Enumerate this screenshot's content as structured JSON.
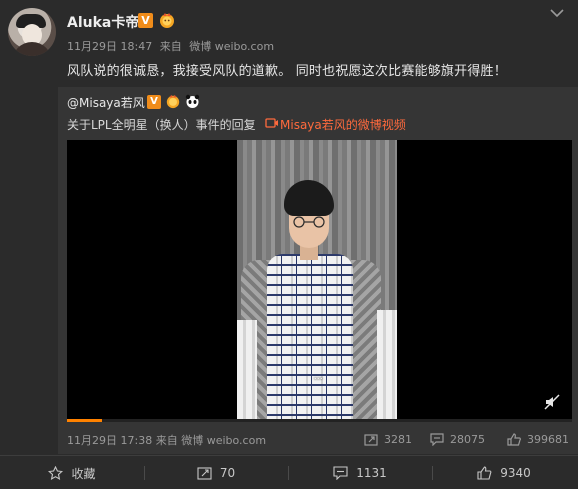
{
  "post": {
    "username": "Aluka卡帝",
    "verified_badge": "V",
    "date": "11月29日 18:47",
    "source_prefix": "来自",
    "source": "微博 weibo.com",
    "text": "风队说的很诚恳，我接受风队的道歉。 同时也祝愿这次比赛能够旗开得胜！"
  },
  "repost": {
    "username": "@Misaya若风",
    "verified_badge": "V",
    "title": "关于LPL全明星（换人）事件的回复",
    "video_link": "Misaya若风的微博视频",
    "video_subtitle": "…",
    "video_progress": 0.07,
    "date": "11月29日 17:38",
    "source_prefix": "来自",
    "source": "微博 weibo.com",
    "reposts": "3281",
    "comments": "28075",
    "likes": "399681"
  },
  "footer": {
    "favorite_label": "收藏",
    "repost_count": "70",
    "comment_count": "1131",
    "like_count": "9340"
  },
  "colors": {
    "background": "#2b2b2b",
    "repost_background": "#353535",
    "badge": "#f08c1a",
    "link": "#ff6a3d",
    "progress": "#ff8200"
  },
  "icons": [
    "chevron-down-icon",
    "verified-icon",
    "sun-badge-icon",
    "panda-icon",
    "camera-icon",
    "mute-icon",
    "repost-icon",
    "comment-icon",
    "like-icon",
    "star-icon"
  ]
}
